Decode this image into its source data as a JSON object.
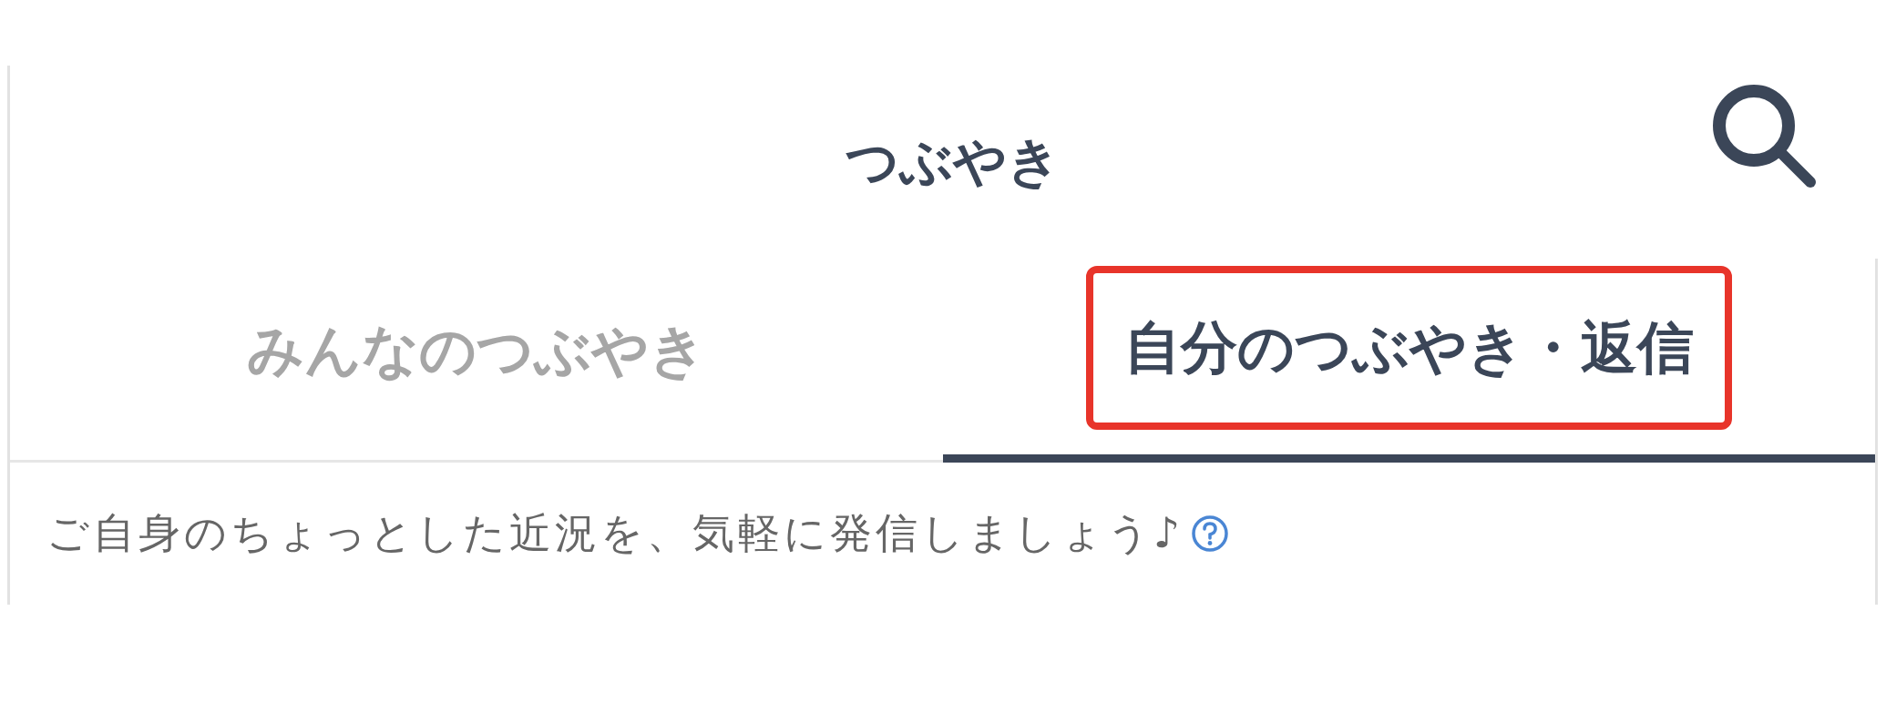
{
  "header": {
    "title": "つぶやき"
  },
  "tabs": [
    {
      "label": "みんなのつぶやき",
      "selected": false,
      "highlighted": false
    },
    {
      "label": "自分のつぶやき・返信",
      "selected": true,
      "highlighted": true
    }
  ],
  "description": {
    "text": "ご自身のちょっとした近況を、気軽に発信しましょう♪"
  }
}
